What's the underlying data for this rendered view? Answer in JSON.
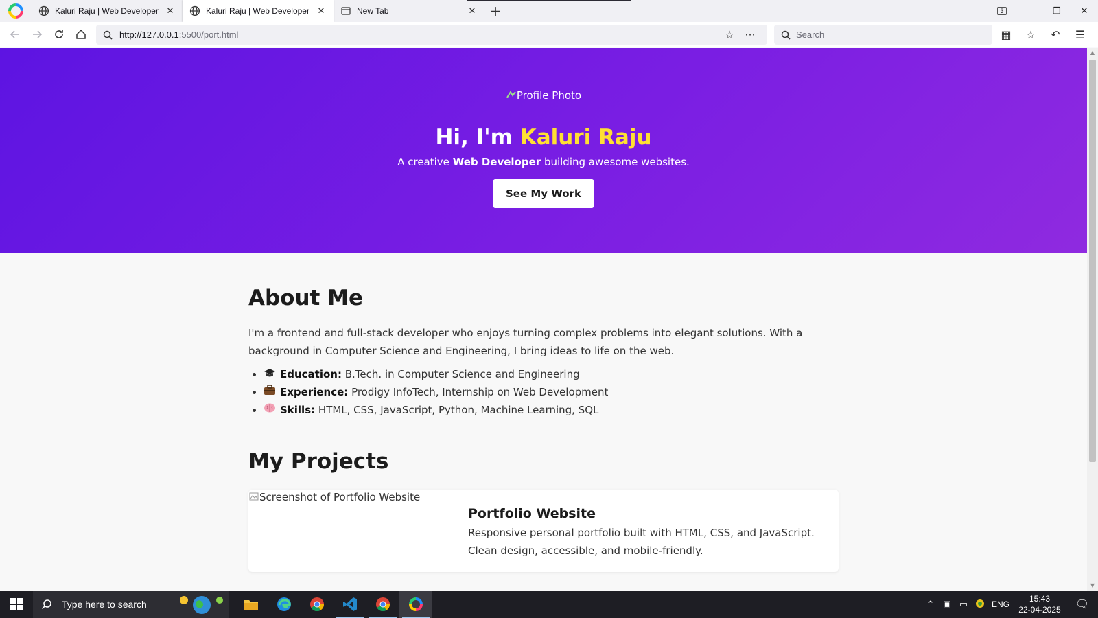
{
  "browser": {
    "tabs": [
      {
        "title": "Kaluri Raju | Web Developer",
        "close": "✕"
      },
      {
        "title": "Kaluri Raju | Web Developer",
        "close": "✕"
      },
      {
        "title": "New Tab",
        "close": "✕"
      }
    ],
    "active_tab": 1,
    "window_counter": "3",
    "url_host": "http://127.0.0.1",
    "url_rest": ":5500/port.html",
    "search_placeholder": "Search"
  },
  "hero": {
    "profile_alt": "Profile Photo",
    "greeting": "Hi, I'm ",
    "name": "Kaluri Raju",
    "subtitle_pre": "A creative ",
    "subtitle_bold": "Web Developer",
    "subtitle_post": " building awesome websites.",
    "cta_label": "See My Work",
    "gradient_start": "#5d14e2",
    "gradient_end": "#8f2ae0",
    "name_color": "#ffe033"
  },
  "about": {
    "heading": "About Me",
    "paragraph": "I'm a frontend and full-stack developer who enjoys turning complex problems into elegant solutions. With a background in Computer Science and Engineering, I bring ideas to life on the web.",
    "items": [
      {
        "icon": "graduation-cap-icon",
        "label": "Education:",
        "value": " B.Tech. in Computer Science and Engineering"
      },
      {
        "icon": "briefcase-icon",
        "label": "Experience:",
        "value": " Prodigy InfoTech, Internship on Web Development"
      },
      {
        "icon": "brain-icon",
        "label": "Skills:",
        "value": " HTML, CSS, JavaScript, Python, Machine Learning, SQL"
      }
    ]
  },
  "projects": {
    "heading": "My Projects",
    "cards": [
      {
        "image_alt": "Screenshot of Portfolio Website",
        "title": "Portfolio Website",
        "description": "Responsive personal portfolio built with HTML, CSS, and JavaScript. Clean design, accessible, and mobile-friendly."
      }
    ]
  },
  "taskbar": {
    "search_placeholder": "Type here to search",
    "apps": [
      "file-explorer-icon",
      "edge-icon",
      "chrome-icon",
      "vscode-icon",
      "chrome-icon",
      "browser-icon"
    ],
    "language": "ENG",
    "time": "15:43",
    "date": "22-04-2025"
  }
}
